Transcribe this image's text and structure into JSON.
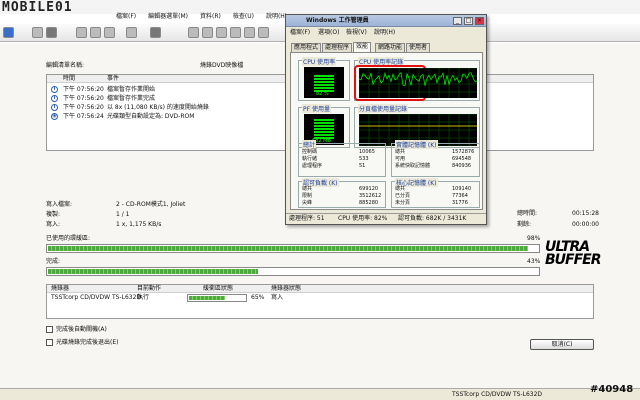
{
  "app": {
    "logo": "MOBILE01",
    "menu": [
      "檔案(F)",
      "編輯器選單(M)",
      "資料(R)",
      "檢查(U)",
      "說明(H)"
    ]
  },
  "log": {
    "project_label": "編輯清單名稱:",
    "disc_type": "燒錄DVD映像檔",
    "col_time": "時間",
    "col_event": "事件",
    "rows": [
      {
        "time": "下午 07:56:20",
        "event": "檔案暫存作業開始"
      },
      {
        "time": "下午 07:56:20",
        "event": "檔案暫存作業完成"
      },
      {
        "time": "下午 07:56:20",
        "event": "以 8x (11,080 KB/s) 的速度開始燒錄"
      },
      {
        "time": "下午 07:56:24",
        "event": "光碟類型自動設定為: DVD-ROM"
      }
    ]
  },
  "info": {
    "write_mode_label": "寫入檔案:",
    "write_mode_value": "2 - CD-ROM模式1, Joliet",
    "copies_label": "複製:",
    "copies_value": "1 / 1",
    "speed_label": "寫入:",
    "speed_value": "1 x, 1,175 KB/s",
    "total_time_label": "總時間:",
    "total_time": "00:15:28",
    "remain_label": "剩餘:",
    "remain_time": "00:00:00"
  },
  "progress": {
    "used_label": "已使用的環緩區:",
    "used_pct_text": "98%",
    "used_pct": 98,
    "done_label": "完成:",
    "done_pct_text": "43%",
    "done_pct": 43
  },
  "brand": {
    "line1": "ULTRA",
    "line2": "BUFFER"
  },
  "devices": {
    "col_drive": "燒錄器",
    "col_action": "目前動作",
    "col_buffer": "緩衝區狀態",
    "col_status": "燒錄器狀態",
    "row": {
      "drive": "TSSTcorp CD/DVDW TS-L632D",
      "action": "執行",
      "buffer_text": "65%",
      "buffer_pct": 65,
      "status": "寫入"
    }
  },
  "options": {
    "shutdown_label": "完成後自動關機(A)",
    "eject_label": "光碟燒錄完成後退出(E)"
  },
  "cancel_label": "取消(C)",
  "status": {
    "drive_text": "TSSTcorp CD/DVDW TS-L632D"
  },
  "watermark": "#40948",
  "taskmgr": {
    "title": "Windows 工作管理員",
    "menu": [
      "檔案(F)",
      "選項(O)",
      "檢視(V)",
      "說明(H)"
    ],
    "tabs": [
      "應用程式",
      "處理程序",
      "效能",
      "網路功能",
      "使用者"
    ],
    "active_tab": 2,
    "cpu_usage_label": "CPU 使用率",
    "cpu_usage_value": "82 %",
    "cpu_history_label": "CPU 使用率記錄",
    "pf_label": "PF 使用量",
    "pf_value": "682 MB",
    "pf_history_label": "分頁檔使用量記錄",
    "totals_label": "總計",
    "totals": [
      {
        "k": "控制碼",
        "v": "10065"
      },
      {
        "k": "執行緒",
        "v": "533"
      },
      {
        "k": "處理程序",
        "v": "51"
      }
    ],
    "physical_label": "實體記憶體 (K)",
    "physical": [
      {
        "k": "總共",
        "v": "1572876"
      },
      {
        "k": "可用",
        "v": "694548"
      },
      {
        "k": "系統快取記憶體",
        "v": "840936"
      }
    ],
    "commit_label": "認可負載 (K)",
    "commit": [
      {
        "k": "總共",
        "v": "699120"
      },
      {
        "k": "限制",
        "v": "3512612"
      },
      {
        "k": "尖峰",
        "v": "885280"
      }
    ],
    "kernel_label": "核心記憶體 (K)",
    "kernel": [
      {
        "k": "總共",
        "v": "109140"
      },
      {
        "k": "已分頁",
        "v": "77364"
      },
      {
        "k": "未分頁",
        "v": "31776"
      }
    ],
    "status_procs": "處理程序: 51",
    "status_cpu": "CPU 使用率: 82%",
    "status_commit": "認可負載: 682K / 3431K",
    "accent": "#e01010",
    "graph_color": "#00ff00"
  }
}
